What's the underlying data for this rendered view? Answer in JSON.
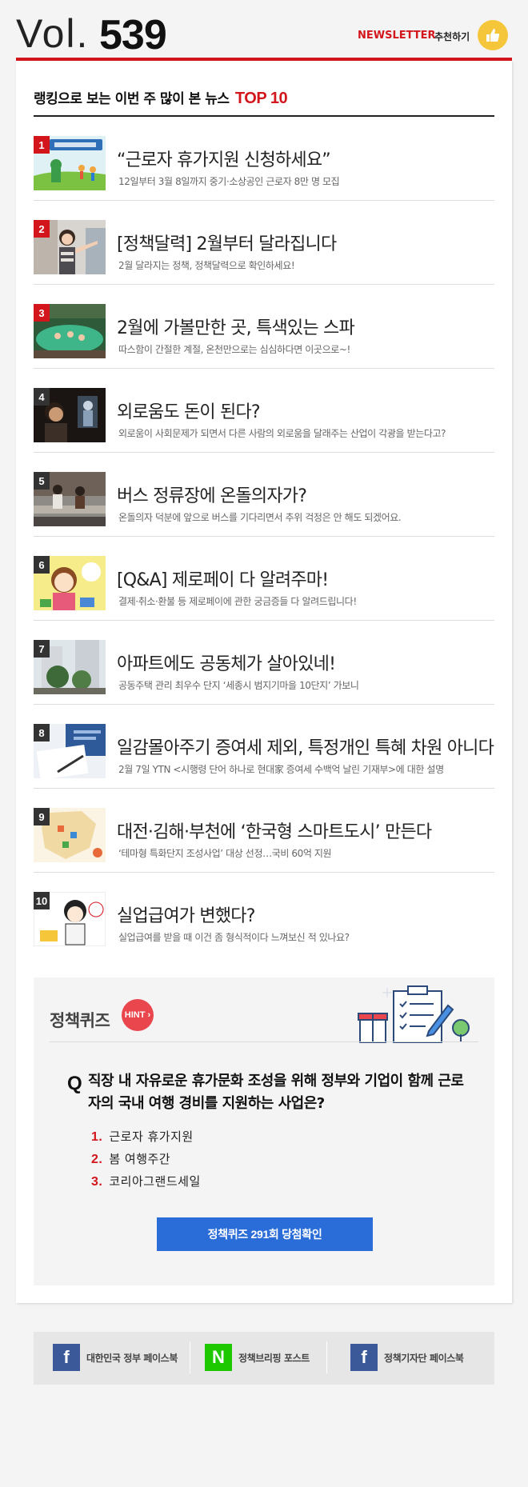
{
  "header": {
    "vol_label": "Vol.",
    "vol_number": "539",
    "newsletter_label": "NEWSLETTER",
    "recommend_label": "추천하기"
  },
  "ranking": {
    "title": "랭킹으로 보는 이번 주 많이 본 뉴스",
    "top_label": "TOP 10",
    "items": [
      {
        "rank": "1",
        "headline": "“근로자 휴가지원 신청하세요”",
        "desc": "12일부터 3월 8일까지 중기·소상공인 근로자 8만 명 모집"
      },
      {
        "rank": "2",
        "headline": "[정책달력] 2월부터 달라집니다",
        "desc": "2월 달라지는 정책, 정책달력으로 확인하세요!"
      },
      {
        "rank": "3",
        "headline": "2월에 가볼만한 곳, 특색있는 스파",
        "desc": "따스함이 간절한 계절, 온천만으로는 심심하다면 이곳으로~!"
      },
      {
        "rank": "4",
        "headline": "외로움도 돈이 된다?",
        "desc": "외로움이 사회문제가 되면서 다른 사람의 외로움을 달래주는 산업이 각광을 받는다고?"
      },
      {
        "rank": "5",
        "headline": "버스 정류장에 온돌의자가?",
        "desc": "온돌의자 덕분에 앞으로 버스를 기다리면서 추위 걱정은 안 해도 되겠어요."
      },
      {
        "rank": "6",
        "headline": "[Q&A] 제로페이 다 알려주마!",
        "desc": "결제·취소·환불 등 제로페이에 관한 궁금증들 다 알려드립니다!"
      },
      {
        "rank": "7",
        "headline": "아파트에도 공동체가 살아있네!",
        "desc": "공동주택 관리 최우수 단지 ‘세종시 범지기마을 10단지’ 가보니"
      },
      {
        "rank": "8",
        "headline": "일감몰아주기 증여세 제외, 특정개인 특혜 차원 아니다",
        "desc": "2월 7일 YTN <시행령 단어 하나로 현대家 증여세 수백억 날린 기재부>에 대한 설명"
      },
      {
        "rank": "9",
        "headline": "대전·김해·부천에 ‘한국형 스마트도시’ 만든다",
        "desc": "‘테마형 특화단지 조성사업’ 대상 선정…국비 60억 지원"
      },
      {
        "rank": "10",
        "headline": "실업급여가 변했다?",
        "desc": "실업급여를 받을 때 이건 좀 형식적이다 느껴보신 적 있나요?"
      }
    ]
  },
  "quiz": {
    "label": "정책퀴즈",
    "hint": "HINT ›",
    "q_mark": "Q",
    "question": "직장 내 자유로운 휴가문화 조성을 위해 정부와 기업이 함께 근로자의 국내 여행 경비를 지원하는 사업은?",
    "options": [
      {
        "num": "1.",
        "text": "근로자 휴가지원"
      },
      {
        "num": "2.",
        "text": "봄 여행주간"
      },
      {
        "num": "3.",
        "text": "코리아그랜드세일"
      }
    ],
    "button": "정책퀴즈 291회 당첨확인"
  },
  "footer": {
    "items": [
      {
        "icon": "f",
        "label": "대한민국 정부 페이스북"
      },
      {
        "icon": "N",
        "label": "정책브리핑 포스트"
      },
      {
        "icon": "f",
        "label": "정책기자단 페이스북"
      }
    ]
  },
  "colors": {
    "accent_red": "#d3151c",
    "quiz_button": "#2a6dd9",
    "facebook_blue": "#3b5998",
    "naver_green": "#1ec800",
    "like_yellow": "#f6c63a"
  }
}
